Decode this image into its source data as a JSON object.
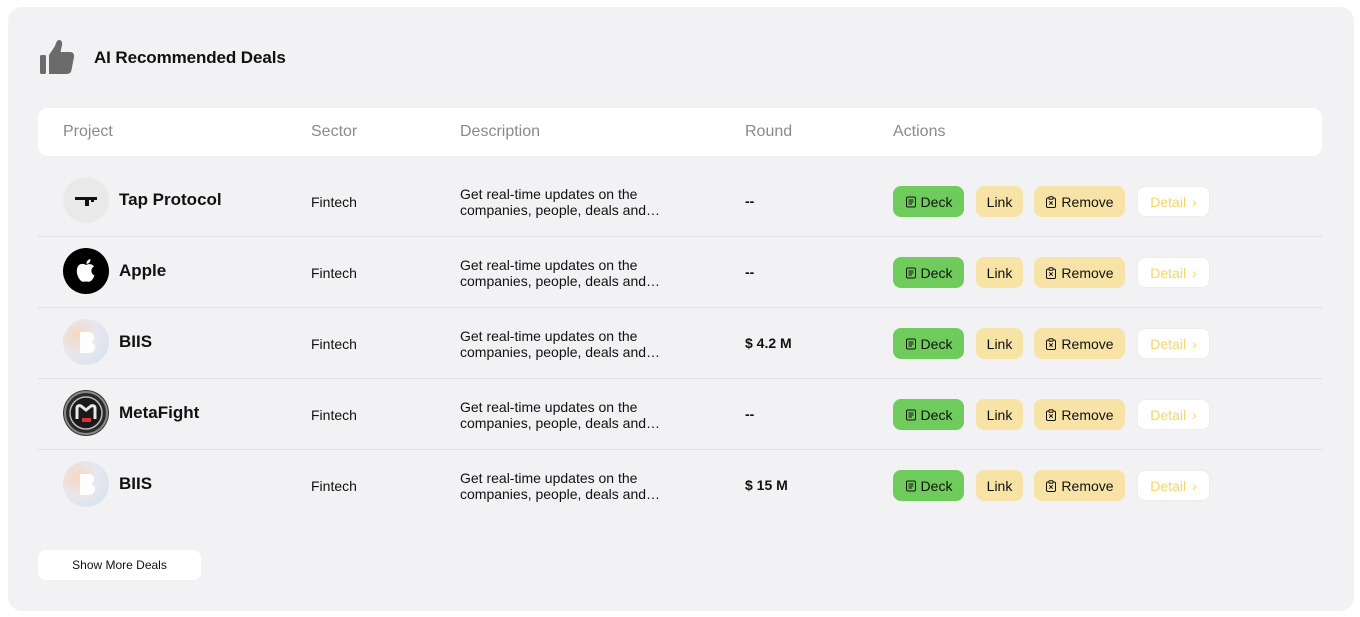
{
  "section": {
    "title": "AI Recommended Deals",
    "icon": "thumbs-up-icon"
  },
  "table": {
    "columns": [
      "Project",
      "Sector",
      "Description",
      "Round",
      "Actions"
    ],
    "rows": [
      {
        "logo": "tap-protocol-logo",
        "name": "Tap Protocol",
        "sector": "Fintech",
        "desc_line1": "Get real-time updates on the",
        "desc_line2": "companies, people, deals and…",
        "round": "--"
      },
      {
        "logo": "apple-logo",
        "name": "Apple",
        "sector": "Fintech",
        "desc_line1": "Get real-time updates on the",
        "desc_line2": "companies, people, deals and…",
        "round": "--"
      },
      {
        "logo": "biis-logo",
        "name": "BIIS",
        "sector": "Fintech",
        "desc_line1": "Get real-time updates on the",
        "desc_line2": "companies, people, deals and…",
        "round": "$ 4.2 M"
      },
      {
        "logo": "metafight-logo",
        "name": "MetaFight",
        "sector": "Fintech",
        "desc_line1": "Get real-time updates on the",
        "desc_line2": "companies, people, deals and…",
        "round": "--"
      },
      {
        "logo": "biis-logo",
        "name": "BIIS",
        "sector": "Fintech",
        "desc_line1": "Get real-time updates on the",
        "desc_line2": "companies, people, deals and…",
        "round": "$ 15 M"
      }
    ]
  },
  "actions": {
    "deck": "Deck",
    "link": "Link",
    "remove": "Remove",
    "detail": "Detail"
  },
  "footer": {
    "show_more": "Show More Deals"
  },
  "colors": {
    "deck_bg": "#6fcc5c",
    "link_bg": "#f8e3a6",
    "remove_bg": "#f8e3a6",
    "detail_text": "#f2d766",
    "card_bg": "#f2f2f4"
  }
}
